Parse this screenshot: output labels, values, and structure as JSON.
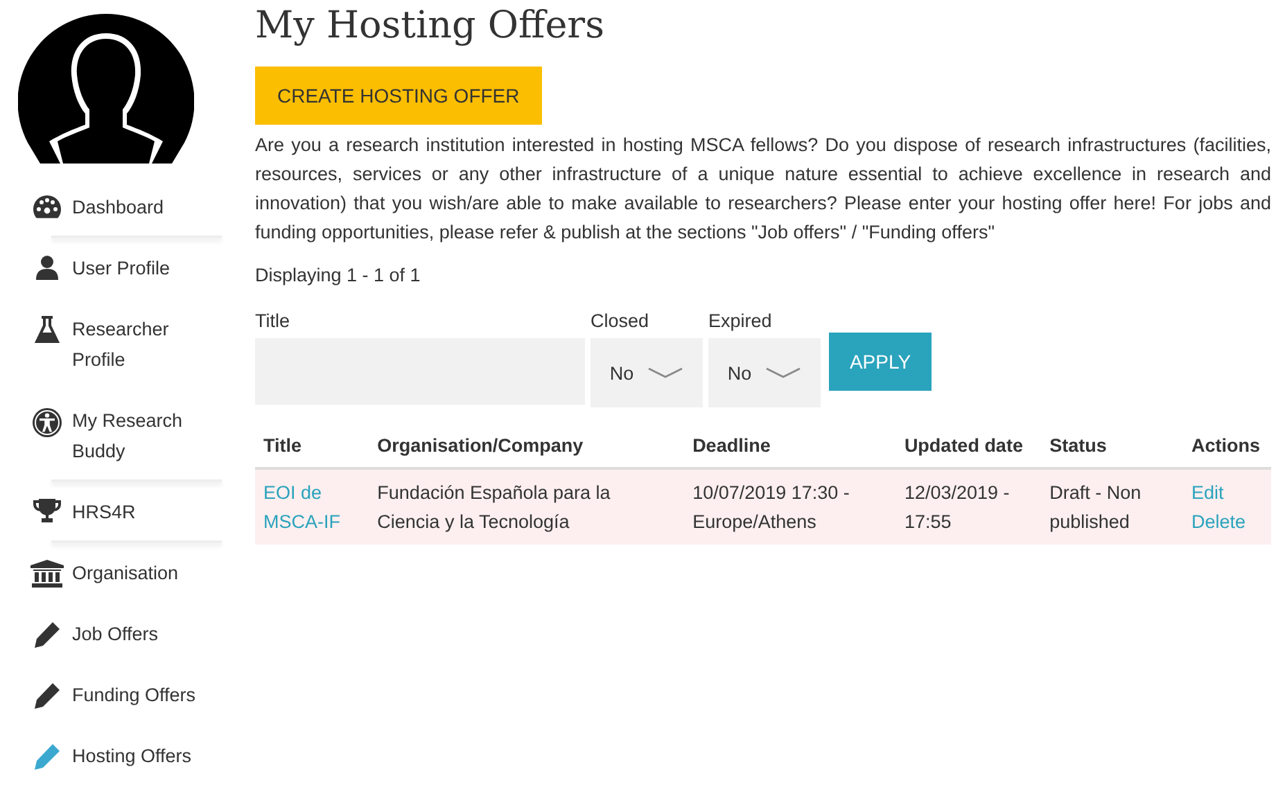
{
  "sidebar": {
    "items": [
      {
        "label": "Dashboard",
        "selected": false,
        "divider_below": true
      },
      {
        "label": "User Profile",
        "selected": false,
        "divider_below": false
      },
      {
        "label": "Researcher Profile",
        "selected": false,
        "divider_below": false
      },
      {
        "label": "My Research Buddy",
        "selected": false,
        "divider_below": true
      },
      {
        "label": "HRS4R",
        "selected": false,
        "divider_below": true
      },
      {
        "label": "Organisation",
        "selected": false,
        "divider_below": false
      },
      {
        "label": "Job Offers",
        "selected": false,
        "divider_below": false
      },
      {
        "label": "Funding Offers",
        "selected": false,
        "divider_below": false
      },
      {
        "label": "Hosting Offers",
        "selected": true,
        "divider_below": false
      }
    ]
  },
  "page": {
    "title": "My Hosting Offers",
    "create_button": "CREATE HOSTING OFFER",
    "intro": "Are you a research institution interested in hosting MSCA fellows? Do you dispose of research infrastructures (facilities, resources, services or any other infrastructure of a unique nature essential to achieve excellence in research and innovation) that you wish/are able to make available to researchers? Please enter your hosting offer here! For jobs and funding opportunities, please refer & publish at the sections \"Job offers\" / \"Funding offers\"",
    "count": "Displaying 1 - 1 of 1"
  },
  "filters": {
    "title_label": "Title",
    "closed_label": "Closed",
    "closed_value": "No",
    "expired_label": "Expired",
    "expired_value": "No",
    "apply_button": "APPLY"
  },
  "table": {
    "columns": [
      "Title",
      "Organisation/Company",
      "Deadline",
      "Updated date",
      "Status",
      "Actions"
    ],
    "rows": [
      {
        "title": "EOI de MSCA-IF",
        "organisation": "Fundación Española para la Ciencia y la Tecnología",
        "deadline": "10/07/2019 17:30 - Europe/Athens",
        "updated": "12/03/2019 - 17:55",
        "status": "Draft - Non published",
        "actions": [
          "Edit",
          "Delete"
        ]
      }
    ]
  }
}
